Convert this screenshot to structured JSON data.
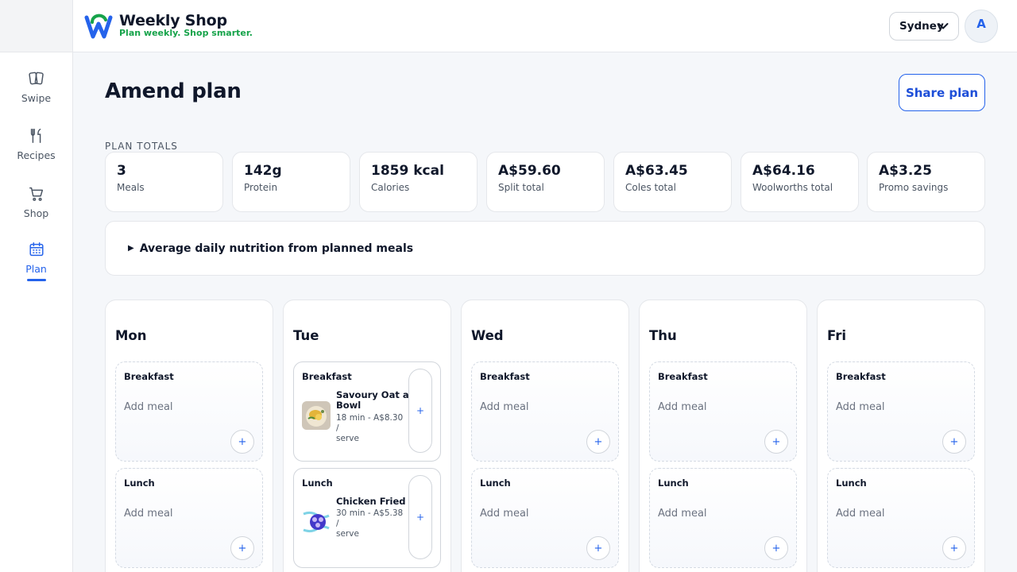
{
  "app": {
    "name": "Weekly Shop",
    "tagline": "Plan weekly. Shop smarter.",
    "brand_colors": {
      "blue": "#2563eb",
      "green": "#16a34a"
    }
  },
  "sidebar": {
    "items": [
      {
        "label": "Swipe",
        "icon": "cards-icon"
      },
      {
        "label": "Recipes",
        "icon": "fork-knife-icon"
      },
      {
        "label": "Shop",
        "icon": "cart-icon"
      },
      {
        "label": "Plan",
        "icon": "calendar-icon",
        "active": true
      }
    ]
  },
  "header": {
    "city": "Sydney",
    "avatar_initial": "A"
  },
  "page": {
    "title": "Amend plan",
    "share_label": "Share plan"
  },
  "totals": {
    "label": "PLAN TOTALS",
    "stats": [
      {
        "value": "3",
        "label": "Meals"
      },
      {
        "value": "142g",
        "label": "Protein"
      },
      {
        "value": "1859 kcal",
        "label": "Calories"
      },
      {
        "value": "A$59.60",
        "label": "Split total"
      },
      {
        "value": "A$63.45",
        "label": "Coles total"
      },
      {
        "value": "A$64.16",
        "label": "Woolworths total"
      },
      {
        "value": "A$3.25",
        "label": "Promo savings"
      }
    ]
  },
  "nutrition": {
    "toggle_icon": "▶",
    "label": "Average daily nutrition from planned meals"
  },
  "plan": {
    "add_meal_label": "Add meal",
    "plus": "+",
    "days": [
      {
        "name": "Mon",
        "slots": [
          {
            "title": "Breakfast"
          },
          {
            "title": "Lunch"
          }
        ]
      },
      {
        "name": "Tue",
        "slots": [
          {
            "title": "Breakfast",
            "meal": {
              "name_line1": "Savoury Oat and",
              "name_line2": "Bowl",
              "meta_line1": "18 min - A$8.30 /",
              "meta_line2": "serve"
            }
          },
          {
            "title": "Lunch",
            "meal": {
              "name_line1": "Chicken Fried Rice",
              "name_line2": "",
              "meta_line1": "30 min - A$5.38 /",
              "meta_line2": "serve"
            }
          }
        ]
      },
      {
        "name": "Wed",
        "slots": [
          {
            "title": "Breakfast"
          },
          {
            "title": "Lunch"
          }
        ]
      },
      {
        "name": "Thu",
        "slots": [
          {
            "title": "Breakfast"
          },
          {
            "title": "Lunch"
          }
        ]
      },
      {
        "name": "Fri",
        "slots": [
          {
            "title": "Breakfast"
          },
          {
            "title": "Lunch"
          }
        ]
      }
    ]
  }
}
